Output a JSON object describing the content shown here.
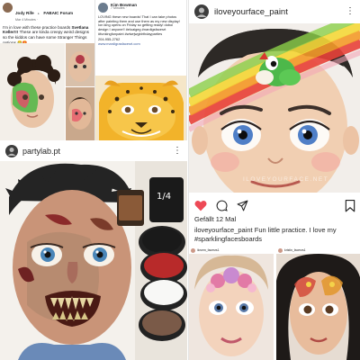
{
  "post_fb_left": {
    "author": "Jody Rife",
    "group_arrow": "▸",
    "group": "FABAIC Forum",
    "meta": "Mar 4 Minutes ·",
    "text_before": "I'm in love with these practice boards",
    "text_tag": "Svetlana Keller!!!",
    "text_after": "These are kinda creepy weird designs so the kiddos can have some Stranger Things options",
    "emoji": "😂😍"
  },
  "post_fb_right": {
    "author": "Kim Bowman",
    "meta": "7 Minutes ·",
    "text": "LOVING these new boards! That I can take photos after painting them and use them as my new display! Ion king opens on Friday so getting ready! doboi design I anyone!! #eloaigeg #nardigsfacesrt #funkingfunpaint #wtwrjwgbirthdayparties",
    "phone": "204-955-2762",
    "site": "www.mardigrasfacesrt.com"
  },
  "post_partylab": {
    "username": "partylab.pt",
    "more": "⋮",
    "label_quarter": "1/4"
  },
  "post_ilove": {
    "username": "iloveyourface_paint",
    "more": "⋮",
    "watermark": "ILOVEYOURFACE.NET",
    "likes": "Gefällt 12 Mal",
    "caption_user": "iloveyourface_paint",
    "caption_text": "Fun little practice. I love my",
    "caption_hashtag": "#sparklingfacesboards",
    "mini_left_user": "ilovem_facesrs1",
    "mini_right_user": "kristin_facesrs1"
  },
  "colors": {
    "like_red": "#ed4956",
    "link_blue": "#385898",
    "ig_text": "#262626"
  }
}
